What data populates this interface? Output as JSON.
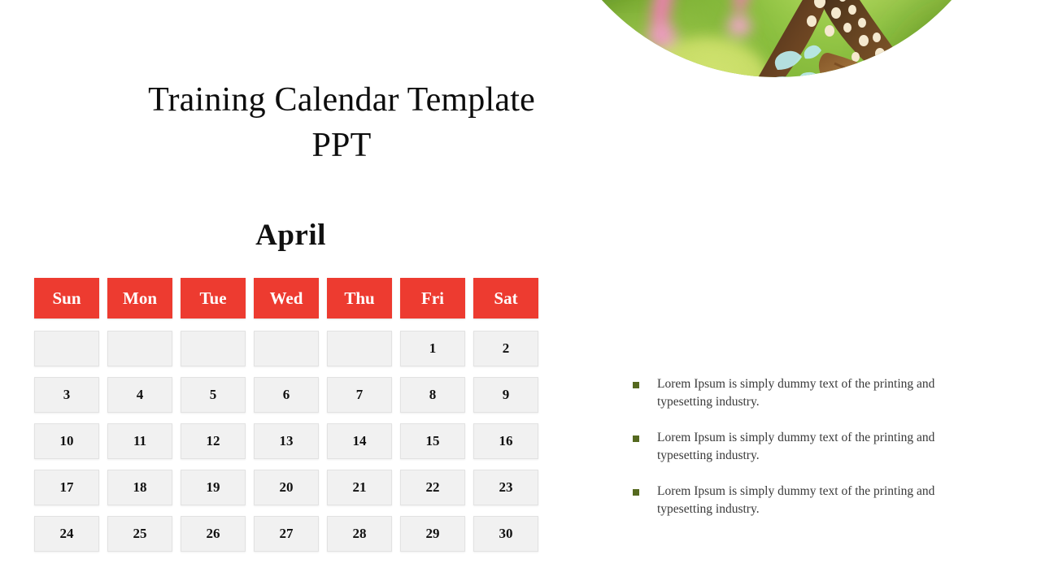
{
  "slide": {
    "title": "Training Calendar Template PPT",
    "month": "April"
  },
  "calendar": {
    "day_headers": [
      "Sun",
      "Mon",
      "Tue",
      "Wed",
      "Thu",
      "Fri",
      "Sat"
    ],
    "header_bg": "#ed3b30",
    "header_text_color": "#ffffff",
    "cell_bg": "#f1f1f1",
    "cell_border": "#e2e2e2",
    "weeks": [
      [
        "",
        "",
        "",
        "",
        "",
        "1",
        "2"
      ],
      [
        "3",
        "4",
        "5",
        "6",
        "7",
        "8",
        "9"
      ],
      [
        "10",
        "11",
        "12",
        "13",
        "14",
        "15",
        "16"
      ],
      [
        "17",
        "18",
        "19",
        "20",
        "21",
        "22",
        "23"
      ],
      [
        "24",
        "25",
        "26",
        "27",
        "28",
        "29",
        "30"
      ]
    ]
  },
  "photo": {
    "alt": "Blue tiger butterfly resting on pink pentas flowers with blurred green foliage background",
    "shape": "circle-with-bottom-left-notch",
    "colors": {
      "background_green_dark": "#4e7d18",
      "background_green_light": "#9ec94a",
      "flower_pink": "#f07ab0",
      "flower_pink_light": "#f9b8d4",
      "butterfly_brown": "#6b4422",
      "butterfly_dark": "#2e1d12",
      "butterfly_cream": "#f5e6c8",
      "butterfly_cyan": "#b9e8ea",
      "stem_yellow_green": "#c9d840"
    }
  },
  "bullets": {
    "marker_color": "#55691f",
    "items": [
      "Lorem Ipsum is simply dummy text of the printing and typesetting industry.",
      "Lorem Ipsum is simply dummy text of the printing and typesetting industry.",
      "Lorem Ipsum is simply dummy text of the printing and typesetting industry."
    ]
  }
}
